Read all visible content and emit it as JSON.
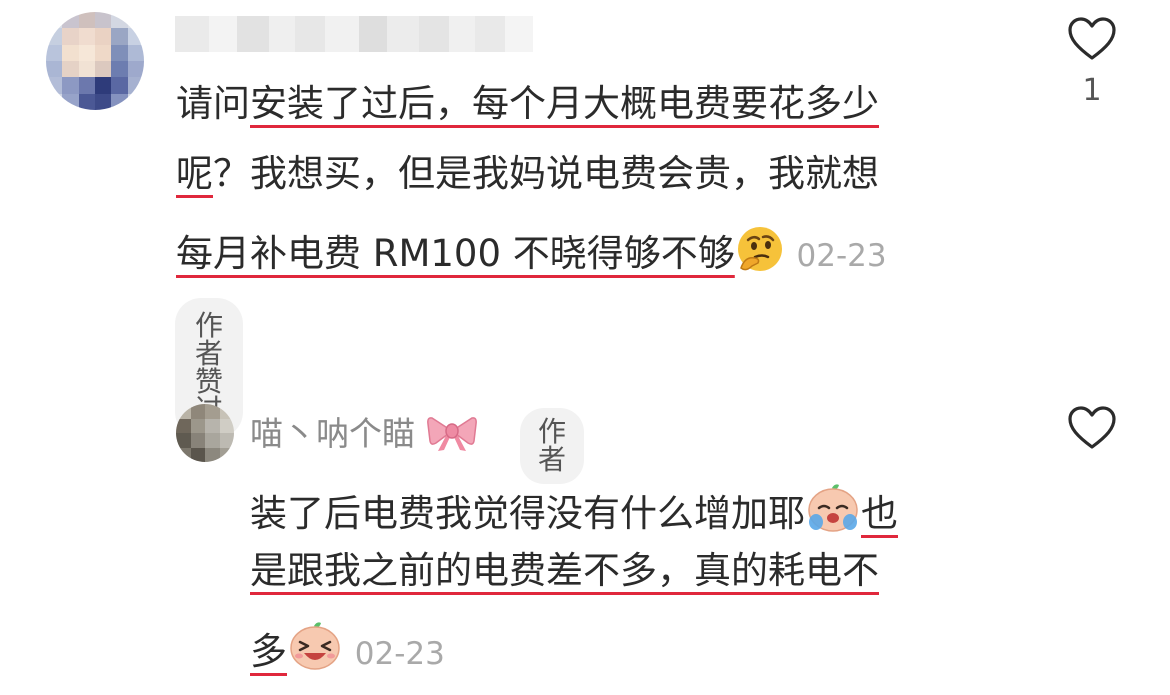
{
  "comments": [
    {
      "lines": [
        {
          "pre": "请问",
          "ul": "安装了过后，每个月大概电费要花多少"
        },
        {
          "ul": "呢",
          "post": "？我想买，但是我妈说电费会贵，我就想"
        },
        {
          "ul": "每月补电费 RM100 不晓得够不够"
        }
      ],
      "time": "02-23",
      "liked_badge": "作者赞过",
      "like_count": "1"
    }
  ],
  "reply": {
    "username": "喵丶呐个瞄",
    "author_badge": "作者",
    "lines": [
      {
        "pre": "装了后电费我觉得没有什么增加耶",
        "ul": "也"
      },
      {
        "ul": "是跟我之前的电费差不多，真的耗电不"
      },
      {
        "ul": "多"
      }
    ],
    "time": "02-23"
  },
  "icons": {
    "like": "heart-outline-icon",
    "thinking": "thinking-face-emoji",
    "crying": "crying-face-emoji",
    "laughing": "laughing-face-emoji",
    "bow": "pink-bow-emoji"
  },
  "colors": {
    "underline": "#e0283c",
    "time": "#a9a9a9",
    "badge_bg": "#f2f2f2"
  }
}
